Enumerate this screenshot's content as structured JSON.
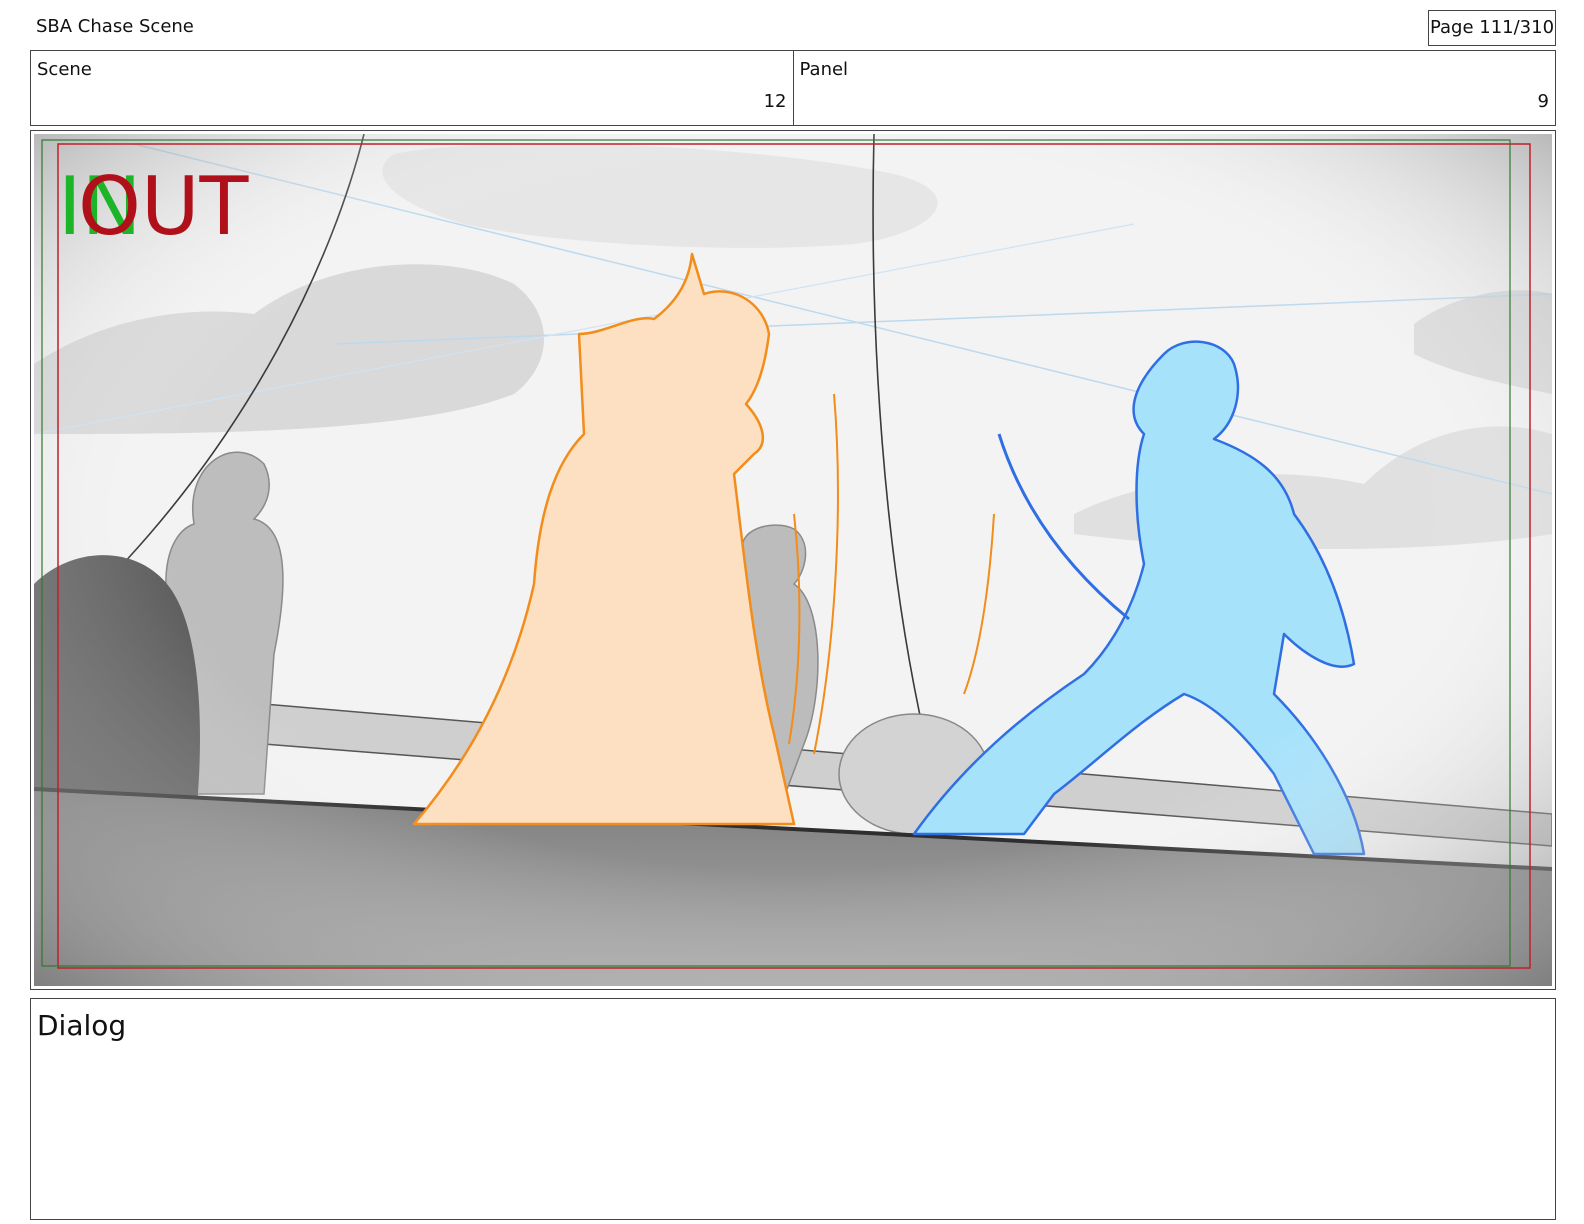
{
  "header": {
    "title": "SBA Chase Scene",
    "page_label": "Page 111/310"
  },
  "info": {
    "scene_label": "Scene",
    "scene_value": "12",
    "panel_label": "Panel",
    "panel_value": "9"
  },
  "panel": {
    "in_marker": "IN",
    "out_marker": "OUT",
    "in_color": "#1db42a",
    "out_color": "#b0101a"
  },
  "dialog": {
    "label": "Dialog"
  }
}
